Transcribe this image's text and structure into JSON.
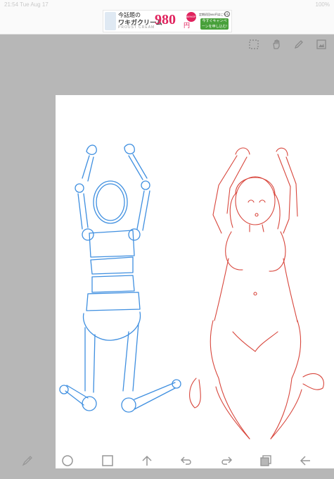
{
  "status_bar": {
    "time": "21:54",
    "date": "Tue Aug 17",
    "battery": "100%"
  },
  "ad": {
    "headline": "今話題の",
    "product_line": "ワキガクリーム",
    "brand": "PROUST CREAM",
    "price": "980",
    "currency": "円",
    "badge": "86%OFF",
    "note": "定期初回980円はこちら",
    "cta": "今すぐキャンペーンを申し込む!"
  },
  "top_toolbar": {
    "icons": [
      "selection-icon",
      "hand-icon",
      "pen-icon",
      "layers-icon"
    ]
  },
  "canvas": {
    "background": "#ffffff",
    "sketch_colors": {
      "blue_mannequin": "#3f8fe0",
      "red_figure": "#d8463c"
    }
  },
  "bottom_toolbar": {
    "icons": [
      "eyedropper-icon",
      "circle-tool-icon",
      "square-tool-icon",
      "arrow-up-icon",
      "undo-icon",
      "redo-icon",
      "layers-stack-icon",
      "back-arrow-icon"
    ]
  },
  "colors": {
    "page_background": "#b7b7b7",
    "icon_gray": "#979797",
    "ad_price": "#e0235e",
    "ad_cta": "#48a03a"
  }
}
